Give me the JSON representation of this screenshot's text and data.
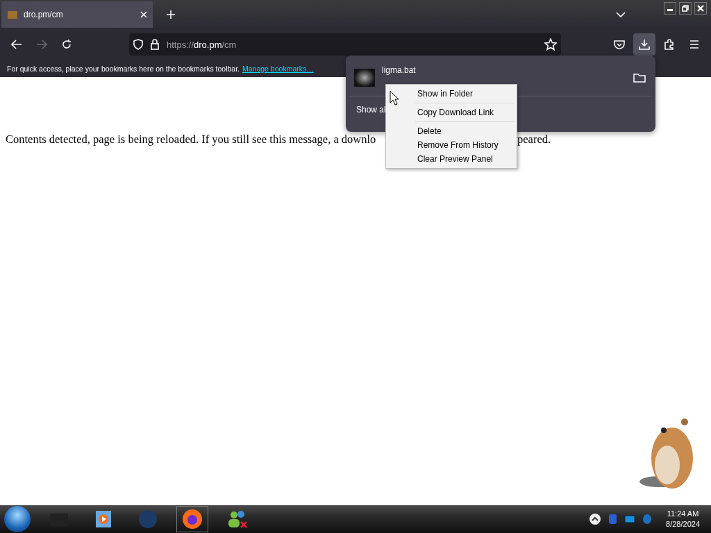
{
  "tabs": [
    {
      "title": "dro.pm/cm",
      "selected": true
    }
  ],
  "address_bar": {
    "scheme": "https://",
    "host": "dro.pm",
    "path": "/cm"
  },
  "bookmarks_bar": {
    "message": "For quick access, place your bookmarks here on the bookmarks toolbar.",
    "link": "Manage bookmarks…"
  },
  "downloads_panel": {
    "file_name": "ligma.bat",
    "show_all": "Show al"
  },
  "context_menu": [
    {
      "label": "Show in Folder",
      "kind": "item"
    },
    {
      "kind": "separator"
    },
    {
      "label": "Copy Download Link",
      "kind": "item"
    },
    {
      "kind": "separator"
    },
    {
      "label": "Delete",
      "kind": "item"
    },
    {
      "label": "Remove From History",
      "kind": "item"
    },
    {
      "label": "Clear Preview Panel",
      "kind": "item"
    }
  ],
  "page_text": [
    "Contents detected, page is being reloaded. If you still see this message, a downlo",
    "peared."
  ],
  "taskbar": {
    "time": "11:24 AM",
    "date": "8/28/2024"
  }
}
